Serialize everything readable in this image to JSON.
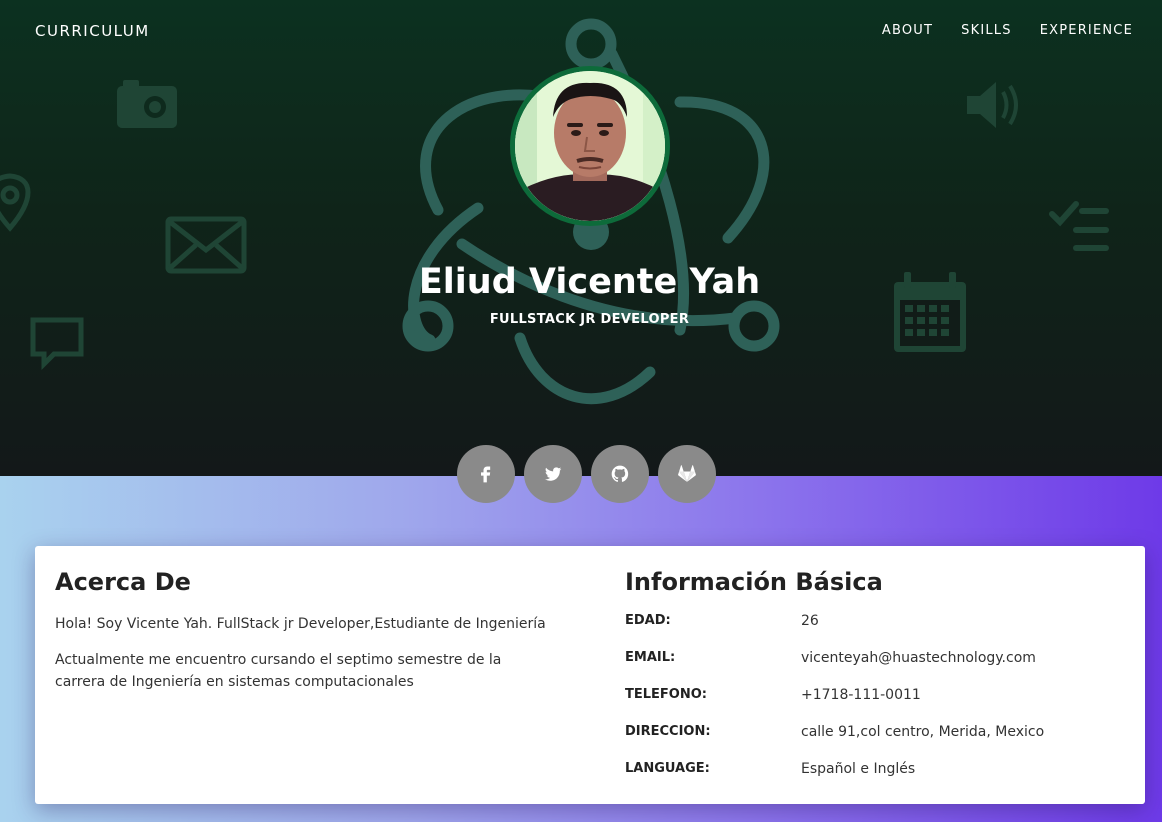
{
  "navbar": {
    "brand": "CURRICULUM",
    "links": [
      "ABOUT",
      "SKILLS",
      "EXPERIENCE"
    ]
  },
  "hero": {
    "name": "Eliud Vicente Yah",
    "role": "FULLSTACK JR DEVELOPER",
    "background_icons": [
      "camera-icon",
      "map-pin-icon",
      "envelope-icon",
      "chat-bubble-icon",
      "atom-icon",
      "volume-icon",
      "checklist-icon",
      "calendar-icon"
    ]
  },
  "socials": [
    {
      "icon": "facebook-icon"
    },
    {
      "icon": "twitter-icon"
    },
    {
      "icon": "github-icon"
    },
    {
      "icon": "gitlab-icon"
    }
  ],
  "about": {
    "title": "Acerca De",
    "paragraphs": [
      "Hola! Soy Vicente Yah. FullStack jr Developer,Estudiante de Ingeniería",
      "Actualmente me encuentro cursando el septimo semestre de la carrera de Ingeniería en sistemas computacionales"
    ]
  },
  "basic_info": {
    "title": "Información Básica",
    "rows": [
      {
        "label": "EDAD:",
        "value": "26"
      },
      {
        "label": "EMAIL:",
        "value": "vicenteyah@huastechnology.com"
      },
      {
        "label": "TELEFONO:",
        "value": "+1718-111-0011"
      },
      {
        "label": "DIRECCION:",
        "value": "calle 91,col centro, Merida, Mexico"
      },
      {
        "label": "LANGUAGE:",
        "value": "Español e Inglés"
      }
    ]
  },
  "colors": {
    "hero_top": "#0c3120",
    "hero_bottom": "#131819",
    "icon_accent": "#2e6158",
    "avatar_border": "#0d6b3a",
    "social_bg": "#8a8a8a",
    "gradient_left": "#a9d2ee",
    "gradient_right": "#6e3ae8"
  }
}
